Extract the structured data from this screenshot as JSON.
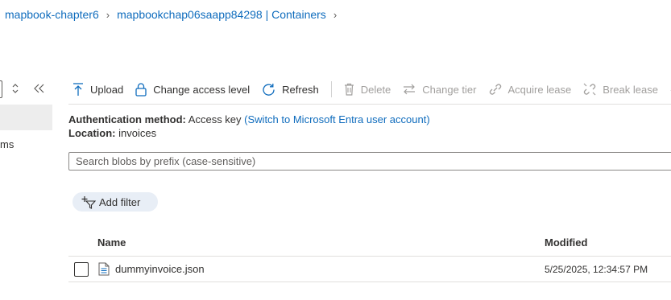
{
  "breadcrumb": {
    "items": [
      "mapbook-chapter6",
      "mapbookchap06saapp84298 | Containers"
    ],
    "separator": "›"
  },
  "sidebar": {
    "partial_item_label": "ms"
  },
  "toolbar": {
    "upload_label": "Upload",
    "change_access_label": "Change access level",
    "refresh_label": "Refresh",
    "delete_label": "Delete",
    "change_tier_label": "Change tier",
    "acquire_lease_label": "Acquire lease",
    "break_lease_label": "Break lease"
  },
  "auth": {
    "label": "Authentication method:",
    "value": "Access key",
    "switch_link": "(Switch to Microsoft Entra user account)"
  },
  "location": {
    "label": "Location:",
    "value": "invoices"
  },
  "search": {
    "placeholder": "Search blobs by prefix (case-sensitive)",
    "value": ""
  },
  "filter": {
    "add_label": "Add filter"
  },
  "table": {
    "columns": [
      "Name",
      "Modified"
    ],
    "rows": [
      {
        "name": "dummyinvoice.json",
        "modified": "5/25/2025, 12:34:57 PM"
      }
    ]
  },
  "colors": {
    "link": "#0f6cbd",
    "text": "#323130",
    "disabled": "#a19f9d",
    "filter_pill": "#e8eef6",
    "sidebar_selected": "#ededed"
  }
}
